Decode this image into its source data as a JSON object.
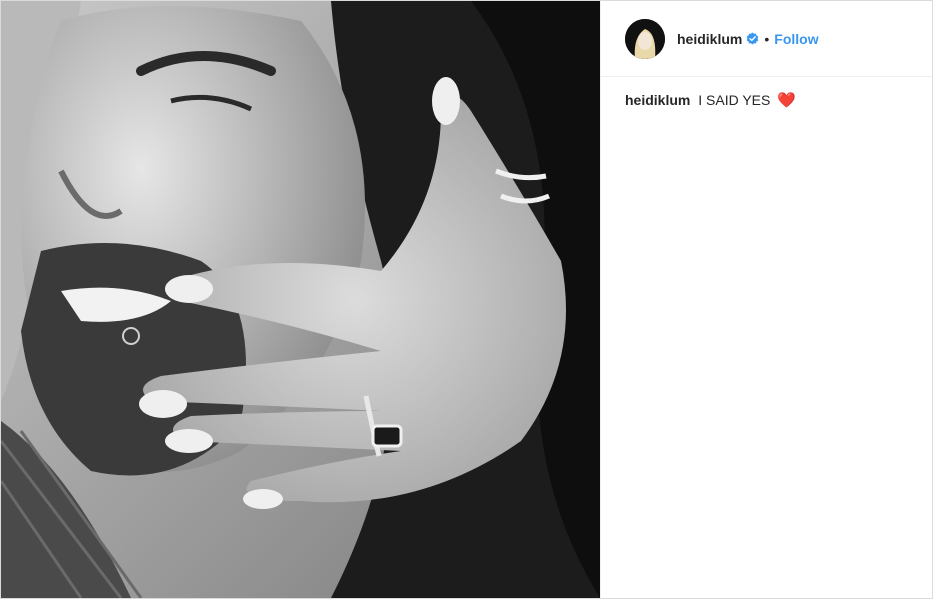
{
  "post": {
    "username": "heidiklum",
    "separator": "•",
    "follow_label": "Follow",
    "caption_user": "heidiklum",
    "caption_text": "I SAID YES",
    "caption_emoji": "❤️",
    "verified_icon": "verified-badge-icon"
  },
  "colors": {
    "link_blue": "#3897f0",
    "text": "#262626",
    "border": "#dbdbdb",
    "heart_red": "#e0202c"
  }
}
